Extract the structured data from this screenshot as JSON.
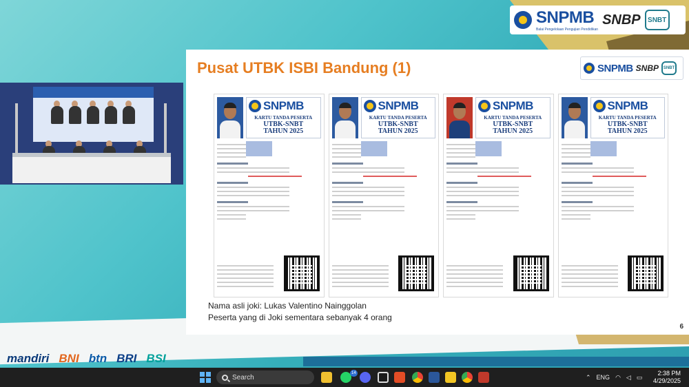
{
  "header_logos": {
    "snpmb": "SNPMB",
    "snpmb_tagline": "Balai Pengelolaan Pengujian Pendidikan",
    "snbp": "SNBP",
    "snbt": "SNBT"
  },
  "slide": {
    "title": "Pusat UTBK ISBI Bandung (1)",
    "page_number": "6",
    "caption_line1": "Nama asli joki: Lukas Valentino Nainggolan",
    "caption_line2": "Peserta yang di Joki sementara sebanyak 4 orang",
    "card": {
      "brand": "SNPMB",
      "heading1": "KARTU TANDA PESERTA",
      "heading2": "UTBK-SNBT",
      "heading3": "TAHUN 2025"
    }
  },
  "sponsors": {
    "mandiri": "mandiri",
    "bni": "BNI",
    "btn": "btn",
    "bri": "BRI",
    "bsi": "BSI"
  },
  "taskbar": {
    "search_label": "Search",
    "notification_count": "14",
    "language": "ENG",
    "time": "2:38 PM",
    "date": "4/29/2025"
  },
  "colors": {
    "title_orange": "#e67e22",
    "brand_blue": "#1a4fa0",
    "taskbar": "#1f1f1f"
  }
}
